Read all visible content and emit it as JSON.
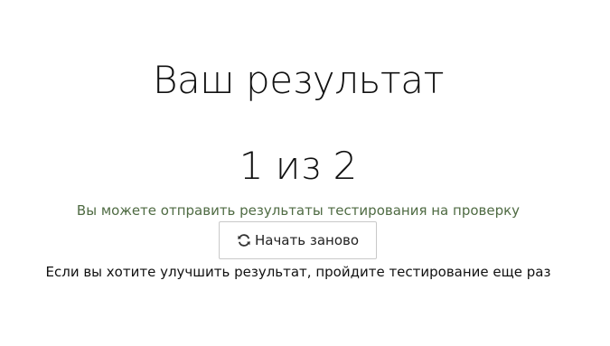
{
  "result": {
    "title": "Ваш результат",
    "score": "1 из 2",
    "submit_hint": "Вы можете отправить результаты тестирования на проверку",
    "restart_label": "Начать заново",
    "restart_icon": "refresh-icon",
    "improve_note": "Если вы хотите улучшить результат, пройдите тестирование еще раз"
  },
  "colors": {
    "hint": "#4f6b43",
    "text": "#111111",
    "button_border": "#c9c9c9"
  }
}
